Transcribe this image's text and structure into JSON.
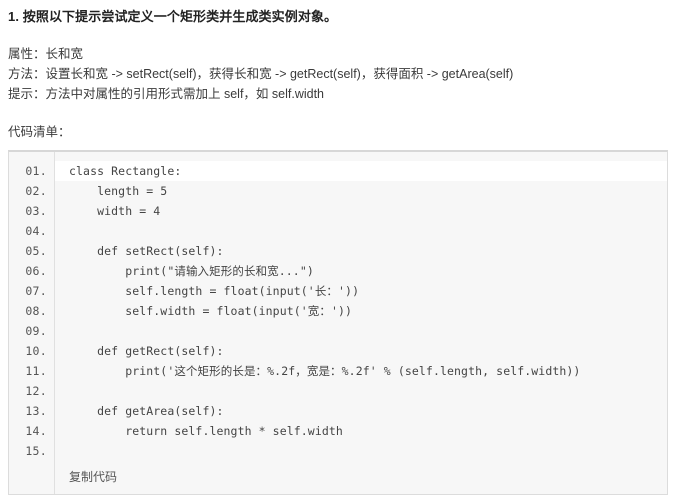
{
  "question": {
    "title": "1. 按照以下提示尝试定义一个矩形类并生成类实例对象。",
    "spec": [
      "属性：长和宽",
      "方法：设置长和宽 -> setRect(self)，获得长和宽 -> getRect(self)，获得面积 -> getArea(self)",
      "提示：方法中对属性的引用形式需加上 self，如 self.width"
    ],
    "code_list_label": "代码清单："
  },
  "code_block": {
    "language": "python",
    "copy_label": "复制代码",
    "line_numbers": [
      "01.",
      "02.",
      "03.",
      "04.",
      "05.",
      "06.",
      "07.",
      "08.",
      "09.",
      "10.",
      "11.",
      "12.",
      "13.",
      "14.",
      "15."
    ],
    "lines": [
      "class Rectangle:",
      "    length = 5",
      "    width = 4",
      "",
      "    def setRect(self):",
      "        print(\"请输入矩形的长和宽...\")",
      "        self.length = float(input('长：'))",
      "        self.width = float(input('宽：'))",
      "",
      "    def getRect(self):",
      "        print('这个矩形的长是：%.2f，宽是：%.2f' % (self.length, self.width))",
      "",
      "    def getArea(self):",
      "        return self.length * self.width",
      ""
    ]
  },
  "colors": {
    "page_background": "#ffffff",
    "code_background": "#f7f7f7",
    "code_border": "#dcdcdc",
    "first_line_highlight": "#ffffff",
    "gutter_text": "#555555",
    "code_text": "#444444",
    "title_text": "#222222",
    "body_text": "#3a3a3a"
  }
}
